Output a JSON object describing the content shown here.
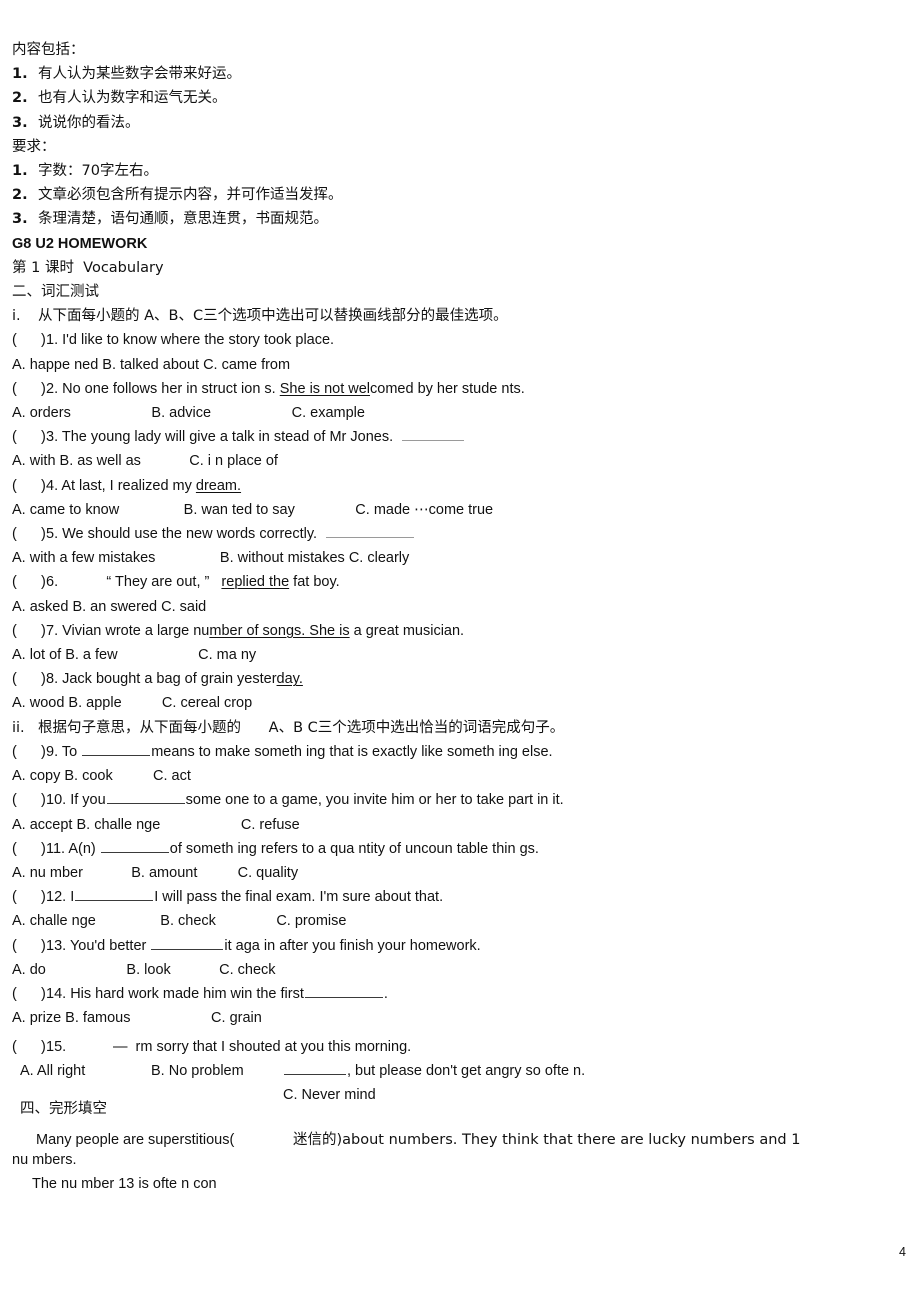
{
  "document": {
    "page_number": "4",
    "writing_prompt": {
      "content_heading": "内容包括：",
      "content_items": [
        "有人认为某些数字会带来好运。",
        "也有人认为数字和运气无关。",
        "说说你的看法。"
      ],
      "requirements_heading": "要求：",
      "requirement_items": [
        "字数：70字左右。",
        "文章必须包含所有提示内容，并可作适当发挥。",
        "条理清楚，语句通顺，意思连贯，书面规范。"
      ],
      "numbers": [
        "1.",
        "2.",
        "3."
      ]
    },
    "homework_title": "G8 U2 HOMEWORK",
    "lesson_line": "第 1 课时  Vocabulary",
    "section_two": {
      "heading": "二、词汇测试",
      "part_i": {
        "marker": "i.",
        "instruction": "从下面每小题的 A、B、C三个选项中选出可以替换画线部分的最佳选项。",
        "questions": [
          {
            "paren": "(      )",
            "number": "1.",
            "stem_pre": " I'd like to know where the story took place.",
            "stem_underlined": "",
            "stem_post": "",
            "options": "A. happe ned B. talked about C. came from"
          },
          {
            "paren": "(      )",
            "number": "2.",
            "stem_pre": " No one follows her in struct ion s. ",
            "stem_underlined": "She is not wel",
            "stem_post": "comed by her stude nts.",
            "options": "A. orders                    B. advice                    C. example"
          },
          {
            "paren": "(      )",
            "number": "3.",
            "stem_pre": " The young lady will give a talk in stead of Mr Jones.  ",
            "stem_underlined": "",
            "stem_post": "",
            "options": "A. with B. as well as            C. i n place of"
          },
          {
            "paren": "(      )",
            "number": "4.",
            "stem_pre": " At last, I realized my ",
            "stem_underlined": "dream.",
            "stem_post": "",
            "options": "A. came to know                B. wan ted to say               C. made ⋯come true"
          },
          {
            "paren": "(      )",
            "number": "5.",
            "stem_pre": " We should use the new words correctly.  ",
            "stem_underlined": "",
            "stem_post": "",
            "options": "A. with a few mistakes                B. without mistakes C. clearly"
          },
          {
            "paren": "(      )",
            "number": "6.",
            "stem_pre": "            “ They are out, ”   ",
            "stem_underlined": "replied the",
            "stem_post": " fat boy.",
            "options": "A. asked B. an swered C. said"
          },
          {
            "paren": "(      )",
            "number": "7.",
            "stem_pre": " Vivian wrote a large nu",
            "stem_underlined": "mber of songs. She is",
            "stem_post": " a great musician.",
            "options": "A. lot of B. a few                    C. ma ny"
          },
          {
            "paren": "(      )",
            "number": "8.",
            "stem_pre": " Jack bought a bag of grain yester",
            "stem_underlined": "day.",
            "stem_post": "",
            "options": "A. wood B. apple          C. cereal crop"
          }
        ]
      },
      "part_ii": {
        "marker": "ii.",
        "instruction": "根据句子意思，从下面每小题的      A、B C三个选项中选出恰当的词语完成句子。",
        "questions": [
          {
            "paren": "(      )",
            "number": "9.",
            "stem_pre": " To ",
            "stem_post": "means to make someth ing that is exactly like someth ing else.",
            "options": "A. copy B. cook          C. act"
          },
          {
            "paren": "(      )",
            "number": "10.",
            "stem_pre": " If you",
            "stem_post": "some one to a game, you invite him or her to take part in it.",
            "options": "A. accept B. challe nge                    C. refuse"
          },
          {
            "paren": "(      )",
            "number": "11.",
            "stem_pre": " A(n) ",
            "stem_post": "of someth ing refers to a qua ntity of uncoun table thin gs.",
            "options": "A. nu mber            B. amount          C. quality"
          },
          {
            "paren": "(      )",
            "number": "12.",
            "stem_pre": " I",
            "stem_post": "I will pass the final exam. I'm sure about that.",
            "options": "A. challe nge                B. check               C. promise"
          },
          {
            "paren": "(      )",
            "number": "13.",
            "stem_pre": " You'd better ",
            "stem_post": "it aga in after you finish your homework.",
            "options": "A. do                    B. look            C. check"
          },
          {
            "paren": "(      )",
            "number": "14.",
            "stem_pre": " His hard work made him win the first",
            "stem_post": ".",
            "options": "A. prize B. famous                    C. grain"
          }
        ],
        "question_15": {
          "paren": "(      )",
          "number": "15.",
          "dash_line": "—  rm sorry that I shouted at you this morning.",
          "option_a": "A. All right",
          "option_b": "B. No problem",
          "continuation": ", but please don't get angry so ofte n.",
          "option_c": "C. Never mind"
        }
      }
    },
    "section_four": {
      "heading": "四、完形填空",
      "cloze_line1_left": "Many people are superstitious(",
      "cloze_line1_right": "迷信的)about numbers. They think that there are lucky numbers and 1",
      "cloze_line2": "nu mbers.",
      "cloze_line3": "The nu mber 13 is ofte n con"
    }
  }
}
